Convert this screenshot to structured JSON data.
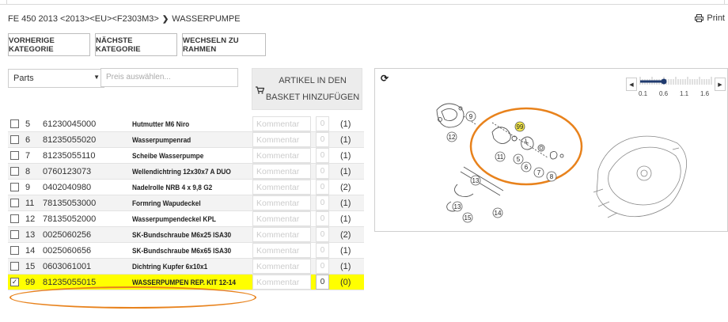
{
  "breadcrumb": {
    "path": "FE 450 2013 <2013><EU><F2303M3>",
    "separator": "❯",
    "current": "WASSERPUMPE"
  },
  "print": {
    "label": "Print"
  },
  "nav_buttons": {
    "prev": "VORHERIGE KATEGORIE",
    "next": "NÄCHSTE KATEGORIE",
    "frame": "WECHSELN ZU RAHMEN"
  },
  "filters": {
    "parts_select": "Parts",
    "price_placeholder": "Preis auswählen..."
  },
  "basket_button": {
    "line1": "ARTIKEL IN DEN",
    "line2": "BASKET HINZUFÜGEN"
  },
  "table": {
    "comment_placeholder": "Kommentar",
    "rows": [
      {
        "pos": "5",
        "number": "61230045000",
        "name": "Hutmutter M6 Niro",
        "qty": "0",
        "count": "(1)",
        "checked": false
      },
      {
        "pos": "6",
        "number": "81235055020",
        "name": "Wasserpumpenrad",
        "qty": "0",
        "count": "(1)",
        "checked": false
      },
      {
        "pos": "7",
        "number": "81235055110",
        "name": "Scheibe Wasserpumpe",
        "qty": "0",
        "count": "(1)",
        "checked": false
      },
      {
        "pos": "8",
        "number": "0760123073",
        "name": "Wellendichtring 12x30x7 A DUO",
        "qty": "0",
        "count": "(1)",
        "checked": false
      },
      {
        "pos": "9",
        "number": "0402040980",
        "name": "Nadelrolle NRB 4 x 9,8 G2",
        "qty": "0",
        "count": "(2)",
        "checked": false
      },
      {
        "pos": "11",
        "number": "78135053000",
        "name": "Formring Wapudeckel",
        "qty": "0",
        "count": "(1)",
        "checked": false
      },
      {
        "pos": "12",
        "number": "78135052000",
        "name": "Wasserpumpendeckel KPL",
        "qty": "0",
        "count": "(1)",
        "checked": false
      },
      {
        "pos": "13",
        "number": "0025060256",
        "name": "SK-Bundschraube M6x25 ISA30",
        "qty": "0",
        "count": "(2)",
        "checked": false
      },
      {
        "pos": "14",
        "number": "0025060656",
        "name": "SK-Bundschraube M6x65 ISA30",
        "qty": "0",
        "count": "(1)",
        "checked": false
      },
      {
        "pos": "15",
        "number": "0603061001",
        "name": "Dichtring Kupfer 6x10x1",
        "qty": "0",
        "count": "(1)",
        "checked": false
      },
      {
        "pos": "99",
        "number": "81235055015",
        "name": "WASSERPUMPEN REP. KIT 12-14",
        "qty": "0",
        "count": "(0)",
        "checked": true
      }
    ]
  },
  "diagram": {
    "refresh_icon": "refresh-icon",
    "zoom_labels": [
      "0.1",
      "0.6",
      "1.1",
      "1.6"
    ],
    "zoom_level": 0.6,
    "callouts": [
      "9",
      "99",
      "12",
      "11",
      "5",
      "6",
      "7",
      "8",
      "13",
      "13",
      "14",
      "15"
    ]
  },
  "colors": {
    "highlight": "#ffff00",
    "annotation": "#e8821c",
    "callout_99": "#f5e94a"
  }
}
